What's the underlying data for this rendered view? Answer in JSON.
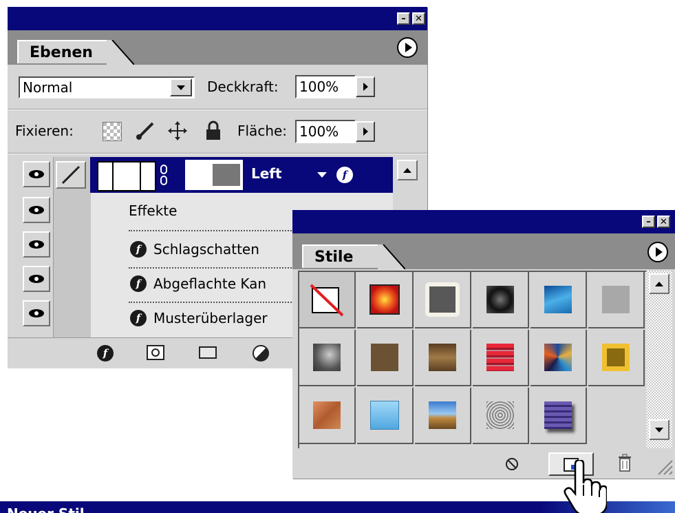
{
  "layers_panel": {
    "tab_label": "Ebenen",
    "blend_mode": "Normal",
    "opacity_label": "Deckkraft:",
    "opacity_value": "100%",
    "lock_label": "Fixieren:",
    "fill_label": "Fläche:",
    "fill_value": "100%",
    "layer_name": "Left",
    "effects_header": "Effekte",
    "effects": [
      "Schlagschatten",
      "Abgeflachte Kan",
      "Musterüberlager"
    ]
  },
  "styles_panel": {
    "tab_label": "Stile",
    "swatches": [
      {
        "name": "none-style-icon"
      },
      {
        "name": "red-glow-icon",
        "color": "#e8281a"
      },
      {
        "name": "gray-outline-icon",
        "color": "#585858"
      },
      {
        "name": "dark-chrome-icon",
        "color": "#2a2a2a"
      },
      {
        "name": "blue-glass-icon",
        "color": "#2a7fc6"
      },
      {
        "name": "light-gray-icon",
        "color": "#a8a8a8"
      },
      {
        "name": "smoke-icon",
        "color": "#6a6a6a"
      },
      {
        "name": "brown-icon",
        "color": "#6b5234"
      },
      {
        "name": "wood-gradient-icon",
        "color": "#7a5c38"
      },
      {
        "name": "red-stripes-icon",
        "color": "#d8233a"
      },
      {
        "name": "color-swirl-icon",
        "color": "#2a6ab0"
      },
      {
        "name": "gold-frame-icon",
        "color": "#e0b020"
      },
      {
        "name": "rust-texture-icon",
        "color": "#c87a4a"
      },
      {
        "name": "light-blue-icon",
        "color": "#6ab6e6"
      },
      {
        "name": "landscape-icon",
        "color": "#4a8ad0"
      },
      {
        "name": "crumpled-paper-icon",
        "color": "#9a9a9a"
      },
      {
        "name": "purple-shadow-icon",
        "color": "#5a4a9a"
      }
    ]
  },
  "bottom_window": {
    "title_partial": "Neuer Stil"
  }
}
